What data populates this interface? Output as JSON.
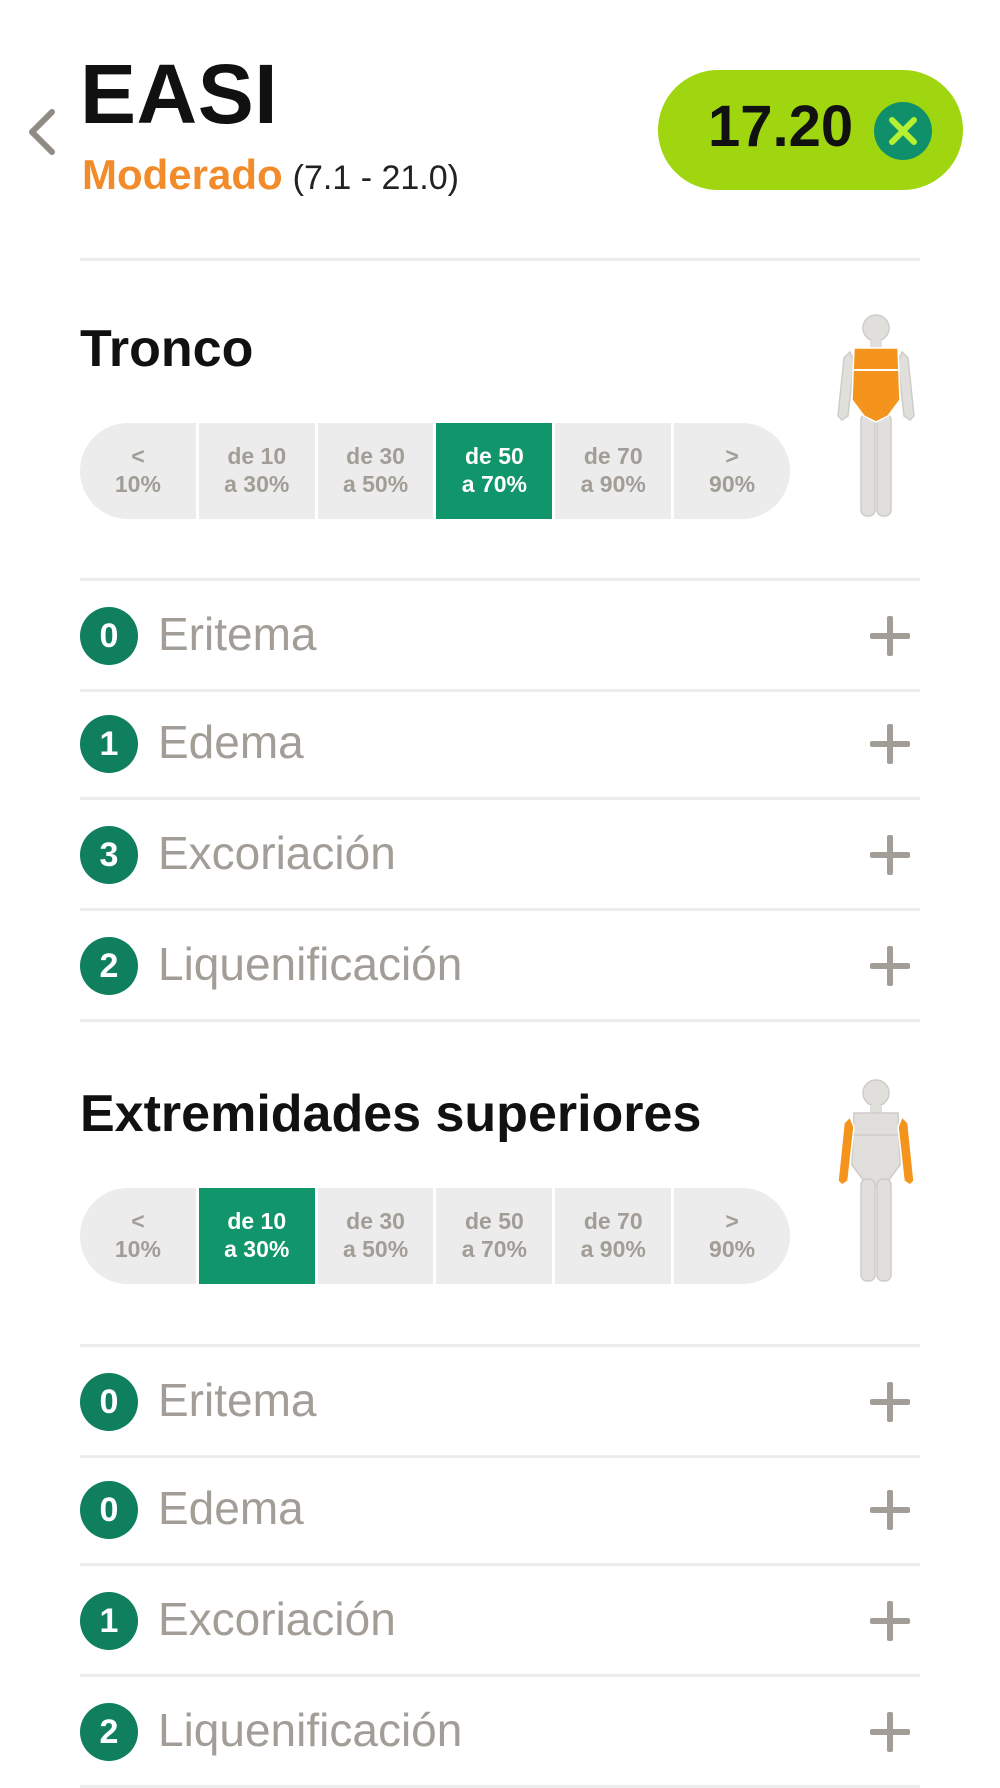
{
  "header": {
    "title": "EASI",
    "severity": "Moderado",
    "range": "(7.1 - 21.0)",
    "score": "17.20",
    "back_icon": "chevron-left-icon",
    "clear_icon": "close-icon"
  },
  "colors": {
    "accent_green": "#11956b",
    "badge_green": "#0f7f5e",
    "score_pill": "#9fd60f",
    "severity_orange": "#f28c2a",
    "muted_text": "#a29d96",
    "body_highlight": "#f5941d"
  },
  "area_options": [
    {
      "line1": "<",
      "line2": "10%"
    },
    {
      "line1": "de 10",
      "line2": "a 30%"
    },
    {
      "line1": "de 30",
      "line2": "a 50%"
    },
    {
      "line1": "de 50",
      "line2": "a 70%"
    },
    {
      "line1": "de 70",
      "line2": "a 90%"
    },
    {
      "line1": ">",
      "line2": "90%"
    }
  ],
  "sections": [
    {
      "title": "Tronco",
      "selected_option_index": 3,
      "body_figure": "body-trunk-highlighted",
      "signs": [
        {
          "value": "0",
          "label": "Eritema"
        },
        {
          "value": "1",
          "label": "Edema"
        },
        {
          "value": "3",
          "label": "Excoriación"
        },
        {
          "value": "2",
          "label": "Liquenificación"
        }
      ]
    },
    {
      "title": "Extremidades superiores",
      "selected_option_index": 1,
      "body_figure": "body-upper-limbs-highlighted",
      "signs": [
        {
          "value": "0",
          "label": "Eritema"
        },
        {
          "value": "0",
          "label": "Edema"
        },
        {
          "value": "1",
          "label": "Excoriación"
        },
        {
          "value": "2",
          "label": "Liquenificación"
        }
      ]
    }
  ]
}
